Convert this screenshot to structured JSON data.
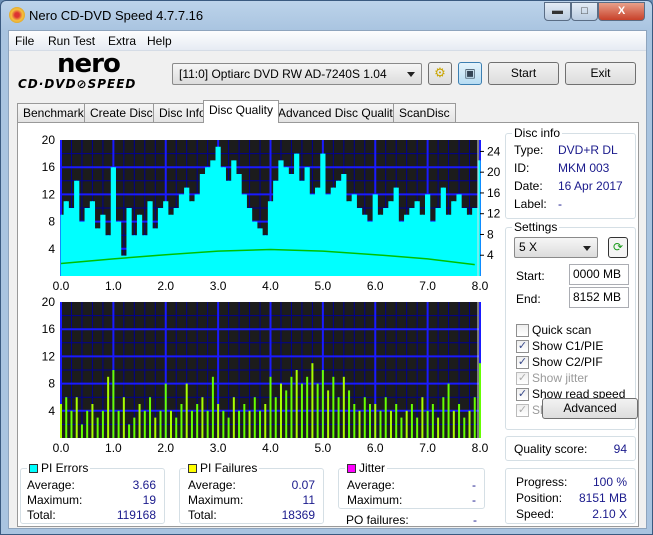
{
  "window": {
    "title": "Nero CD-DVD Speed 4.7.7.16",
    "minimize": "▬",
    "maximize": "□",
    "close": "X"
  },
  "menu": [
    "File",
    "Run Test",
    "Extra",
    "Help"
  ],
  "logo": {
    "top": "nero",
    "bottom": "CD·DVD⊘SPEED"
  },
  "toolbar": {
    "drive": "[11:0]  Optiarc DVD RW AD-7240S 1.04",
    "start": "Start",
    "exit": "Exit"
  },
  "tabs": [
    "Benchmark",
    "Create Disc",
    "Disc Info",
    "Disc Quality",
    "Advanced Disc Quality",
    "ScanDisc"
  ],
  "active_tab": "Disc Quality",
  "disc_info": {
    "caption": "Disc info",
    "type_label": "Type:",
    "type": "DVD+R DL",
    "id_label": "ID:",
    "id": "MKM 003",
    "date_label": "Date:",
    "date": "16 Apr 2017",
    "label_label": "Label:",
    "label": "-"
  },
  "settings": {
    "caption": "Settings",
    "speed": "5 X",
    "start_label": "Start:",
    "start": "0000 MB",
    "end_label": "End:",
    "end": "8152 MB",
    "checks": [
      {
        "label": "Quick scan",
        "checked": false,
        "enabled": true
      },
      {
        "label": "Show C1/PIE",
        "checked": true,
        "enabled": true
      },
      {
        "label": "Show C2/PIF",
        "checked": true,
        "enabled": true
      },
      {
        "label": "Show jitter",
        "checked": true,
        "enabled": false
      },
      {
        "label": "Show read speed",
        "checked": true,
        "enabled": true
      },
      {
        "label": "Show write speed",
        "checked": true,
        "enabled": false
      }
    ],
    "advanced": "Advanced"
  },
  "quality": {
    "label": "Quality score:",
    "value": "94"
  },
  "progress": {
    "progress_label": "Progress:",
    "progress": "100 %",
    "position_label": "Position:",
    "position": "8151 MB",
    "speed_label": "Speed:",
    "speed": "2.10 X"
  },
  "pi_errors": {
    "caption": "PI Errors",
    "color": "#00ffff",
    "average_label": "Average:",
    "average": "3.66",
    "maximum_label": "Maximum:",
    "maximum": "19",
    "total_label": "Total:",
    "total": "119168"
  },
  "pi_failures": {
    "caption": "PI Failures",
    "color": "#ffff00",
    "average_label": "Average:",
    "average": "0.07",
    "maximum_label": "Maximum:",
    "maximum": "11",
    "total_label": "Total:",
    "total": "18369"
  },
  "jitter": {
    "caption": "Jitter",
    "color": "#ff00ff",
    "average_label": "Average:",
    "average": "-",
    "maximum_label": "Maximum:",
    "maximum": "-",
    "po_label": "PO failures:",
    "po": "-"
  },
  "chart_data": [
    {
      "type": "area",
      "name": "PI Errors",
      "color": "#00ffff",
      "x_ticks": [
        "0.0",
        "1.0",
        "2.0",
        "3.0",
        "4.0",
        "5.0",
        "6.0",
        "7.0",
        "8.0"
      ],
      "xlim": [
        0,
        8
      ],
      "ylim": [
        0,
        20
      ],
      "y_ticks": [
        "20",
        "16",
        "12",
        "8",
        "4"
      ],
      "y2lim": [
        0,
        26.2
      ],
      "y2_ticks": [
        "24",
        "20",
        "16",
        "12",
        "8",
        "4"
      ],
      "grid": true,
      "x_step": 0.1,
      "values": [
        9,
        11,
        10,
        14,
        8,
        10,
        11,
        7,
        9,
        6,
        16,
        8,
        3,
        10,
        6,
        9,
        6,
        11,
        7,
        10,
        11,
        9,
        10,
        12,
        13,
        11,
        12,
        15,
        16,
        17,
        19,
        16,
        14,
        17,
        15,
        12,
        10,
        8,
        7,
        6,
        11,
        14,
        17,
        16,
        15,
        18,
        14,
        16,
        12,
        13,
        18,
        12,
        13,
        14,
        15,
        11,
        12,
        10,
        9,
        8,
        12,
        9,
        10,
        11,
        13,
        8,
        9,
        10,
        11,
        9,
        12,
        8,
        10,
        13,
        9,
        11,
        12,
        10,
        9,
        10,
        17
      ],
      "read_speed": {
        "color": "#00c000",
        "x": [
          0,
          1,
          2,
          3,
          4,
          5,
          6,
          7,
          7.9
        ],
        "values": [
          2.4,
          3.3,
          4.1,
          4.8,
          5.1,
          4.8,
          4.1,
          3.3,
          2.2
        ]
      }
    },
    {
      "type": "bar",
      "name": "PI Failures",
      "color": "#66ff00",
      "x_ticks": [
        "0.0",
        "1.0",
        "2.0",
        "3.0",
        "4.0",
        "5.0",
        "6.0",
        "7.0",
        "8.0"
      ],
      "xlim": [
        0,
        8
      ],
      "ylim": [
        0,
        20
      ],
      "y_ticks": [
        "20",
        "16",
        "12",
        "8",
        "4"
      ],
      "grid": true,
      "x_step": 0.1,
      "values": [
        5,
        6,
        4,
        6,
        2,
        4,
        5,
        3,
        4,
        9,
        10,
        4,
        6,
        2,
        3,
        5,
        4,
        6,
        3,
        4,
        8,
        4,
        3,
        5,
        8,
        4,
        5,
        6,
        4,
        9,
        5,
        4,
        3,
        6,
        4,
        5,
        4,
        6,
        4,
        5,
        9,
        6,
        8,
        7,
        9,
        10,
        8,
        9,
        11,
        8,
        10,
        7,
        9,
        6,
        9,
        7,
        5,
        4,
        6,
        5,
        5,
        4,
        6,
        4,
        5,
        3,
        4,
        5,
        3,
        6,
        4,
        5,
        3,
        6,
        8,
        4,
        5,
        3,
        4,
        6,
        11
      ]
    }
  ]
}
